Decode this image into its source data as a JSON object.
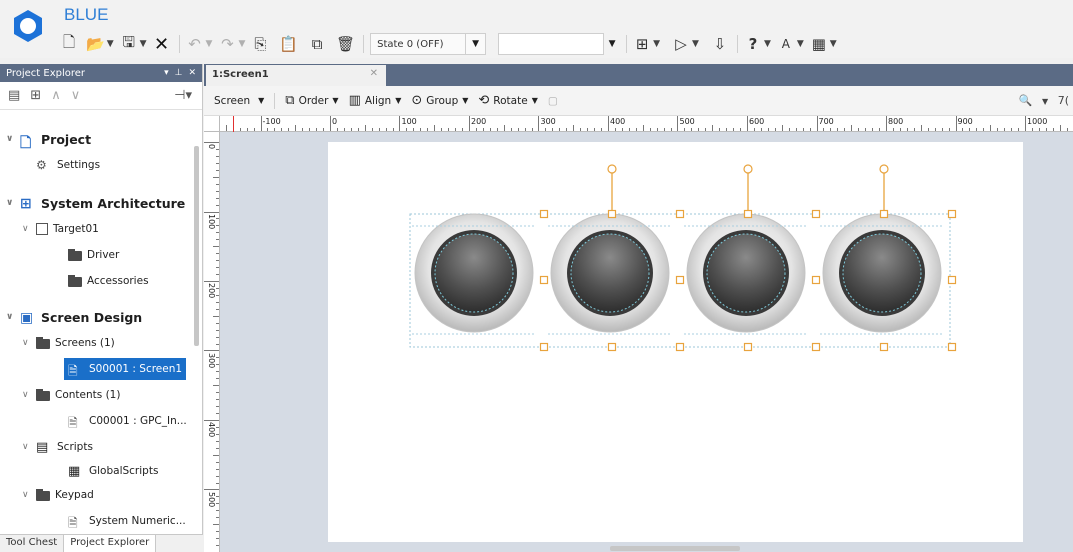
{
  "app": {
    "title": "BLUE"
  },
  "toolbar": {
    "state_label": "State 0 (OFF)"
  },
  "project_explorer": {
    "title": "Project Explorer",
    "tree": [
      {
        "label": "Project",
        "level": 0,
        "section": true,
        "icon": "project-icon"
      },
      {
        "label": "Settings",
        "level": 1,
        "icon": "gear-icon"
      },
      {
        "label": "System Architecture",
        "level": 0,
        "section": true,
        "icon": "architecture-icon"
      },
      {
        "label": "Target01",
        "level": 1,
        "icon": "target-icon"
      },
      {
        "label": "Driver",
        "level": 2,
        "icon": "folder-icon"
      },
      {
        "label": "Accessories",
        "level": 2,
        "icon": "folder-icon"
      },
      {
        "label": "Screen Design",
        "level": 0,
        "section": true,
        "icon": "screen-design-icon"
      },
      {
        "label": "Screens (1)",
        "level": 1,
        "icon": "folder-icon"
      },
      {
        "label": "S00001 : Screen1",
        "level": 2,
        "icon": "screen-doc-icon",
        "selected": true
      },
      {
        "label": "Contents (1)",
        "level": 1,
        "icon": "folder-icon"
      },
      {
        "label": "C00001 : GPC_In...",
        "level": 2,
        "icon": "doc-icon"
      },
      {
        "label": "Scripts",
        "level": 1,
        "icon": "scripts-icon"
      },
      {
        "label": "GlobalScripts",
        "level": 2,
        "icon": "global-scripts-icon"
      },
      {
        "label": "Keypad",
        "level": 1,
        "icon": "folder-icon"
      },
      {
        "label": "System Numeric...",
        "level": 2,
        "icon": "doc-icon"
      }
    ],
    "bottom_tabs": [
      "Tool Chest",
      "Project Explorer"
    ]
  },
  "editor": {
    "tab_label": "1:Screen1",
    "toolbar": {
      "screen": "Screen",
      "order": "Order",
      "align": "Align",
      "group": "Group",
      "rotate": "Rotate",
      "zoom": "7("
    },
    "ruler_h_labels": [
      "-100",
      "0",
      "100",
      "200",
      "300",
      "400",
      "500",
      "600",
      "700",
      "800",
      "900",
      "1000"
    ],
    "ruler_v_labels": [
      "0",
      "100",
      "200",
      "300",
      "400",
      "500"
    ],
    "buttons_count": 4
  }
}
